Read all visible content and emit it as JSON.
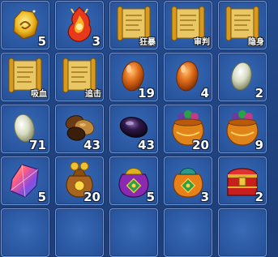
{
  "inventory": {
    "slots": [
      {
        "icon": "golden-rune-stone-icon",
        "count": "5",
        "tag": ""
      },
      {
        "icon": "red-flame-crest-icon",
        "count": "3",
        "tag": ""
      },
      {
        "icon": "golden-scroll-icon",
        "count": "",
        "tag": "狂暴"
      },
      {
        "icon": "golden-scroll-icon",
        "count": "",
        "tag": "审判"
      },
      {
        "icon": "golden-scroll-icon",
        "count": "",
        "tag": "隐身"
      },
      {
        "icon": "golden-scroll-icon",
        "count": "",
        "tag": "吸血"
      },
      {
        "icon": "golden-scroll-icon",
        "count": "",
        "tag": "追击"
      },
      {
        "icon": "orange-egg-icon",
        "count": "19",
        "tag": ""
      },
      {
        "icon": "orange-egg-icon",
        "count": "4",
        "tag": ""
      },
      {
        "icon": "pale-green-egg-icon",
        "count": "2",
        "tag": ""
      },
      {
        "icon": "pale-green-egg-icon",
        "count": "71",
        "tag": ""
      },
      {
        "icon": "brown-beans-icon",
        "count": "43",
        "tag": ""
      },
      {
        "icon": "dark-purple-bean-icon",
        "count": "43",
        "tag": ""
      },
      {
        "icon": "gem-treasure-pot-icon",
        "count": "20",
        "tag": ""
      },
      {
        "icon": "gem-treasure-pot-icon",
        "count": "9",
        "tag": ""
      },
      {
        "icon": "rainbow-crystal-icon",
        "count": "5",
        "tag": ""
      },
      {
        "icon": "coin-money-bag-icon",
        "count": "20",
        "tag": ""
      },
      {
        "icon": "purple-lucky-bag-icon",
        "count": "5",
        "tag": ""
      },
      {
        "icon": "orange-lucky-bag-icon",
        "count": "3",
        "tag": ""
      },
      {
        "icon": "red-treasure-chest-icon",
        "count": "2",
        "tag": ""
      },
      {
        "icon": "",
        "count": "",
        "tag": ""
      },
      {
        "icon": "",
        "count": "",
        "tag": ""
      },
      {
        "icon": "",
        "count": "",
        "tag": ""
      },
      {
        "icon": "",
        "count": "",
        "tag": ""
      },
      {
        "icon": "",
        "count": "",
        "tag": ""
      }
    ]
  },
  "colors": {
    "panel_bg": "#1f3f7a",
    "slot_bg": "#2c5aa4",
    "slot_border": "#6f98d6",
    "count_text": "#ffffff"
  }
}
